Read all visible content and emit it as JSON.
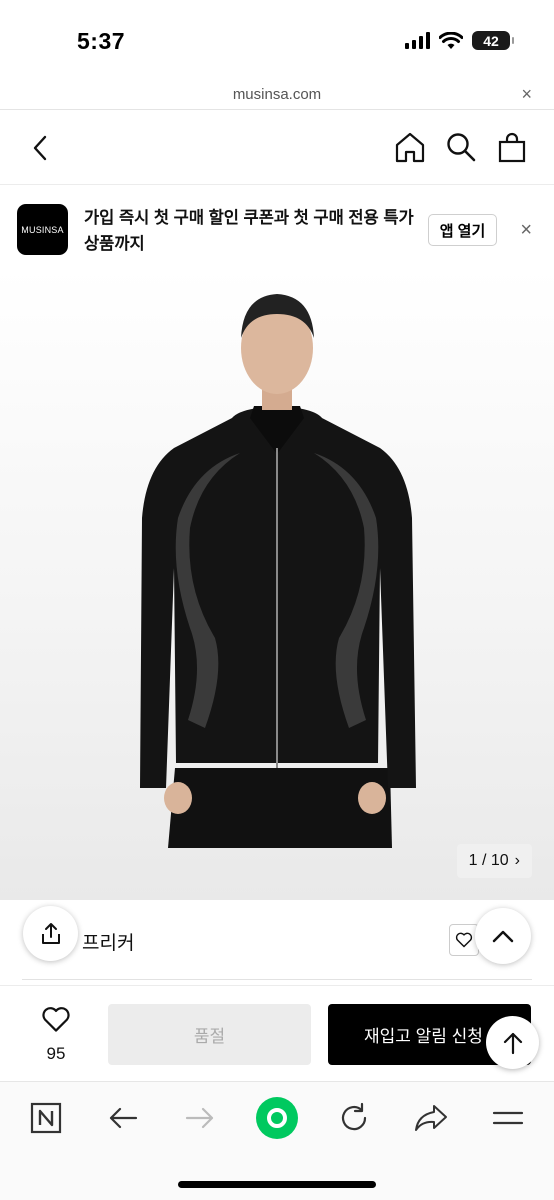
{
  "status_bar": {
    "time": "5:37",
    "battery": "42"
  },
  "url_bar": {
    "url": "musinsa.com",
    "close": "×"
  },
  "app_banner": {
    "logo": "MUSINSA",
    "text": "가입 즉시 첫 구매 할인 쿠폰과 첫 구매 전용 특가 상품까지",
    "open_label": "앱 열기",
    "close": "×"
  },
  "gallery": {
    "counter": "1 / 10",
    "chevron": "›"
  },
  "product": {
    "name": "프리커"
  },
  "action_bar": {
    "like_count": "95",
    "soldout_label": "품절",
    "restock_label": "재입고 알림 신청"
  },
  "colors": {
    "accent_green": "#00c95f",
    "primary": "#000000",
    "disabled_bg": "#ececec"
  },
  "icons": [
    "chevron-left-icon",
    "home-icon",
    "search-icon",
    "bag-icon",
    "share-icon",
    "heart-icon",
    "chevron-up-icon",
    "arrow-up-icon",
    "naver-n-icon",
    "arrow-left-icon",
    "arrow-right-icon",
    "green-dot-icon",
    "reload-icon",
    "share-arrow-icon",
    "menu-icon"
  ]
}
